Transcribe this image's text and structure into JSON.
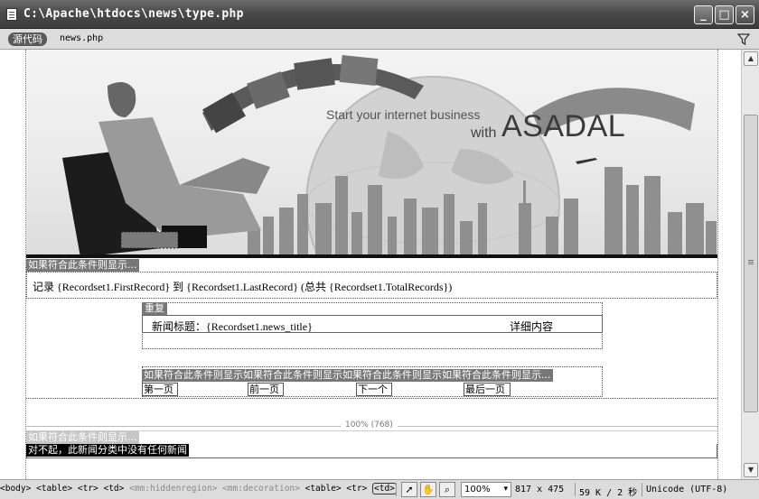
{
  "window": {
    "title": "C:\\Apache\\htdocs\\news\\type.php",
    "buttons": {
      "minimize": "_",
      "maximize": "□",
      "close": "×"
    }
  },
  "tabs": {
    "source_label": "源代码",
    "file_label": "news.php"
  },
  "banner": {
    "tagline": "Start your internet business",
    "with": "with",
    "brand": "ASADAL"
  },
  "content": {
    "condition_label": "如果符合此条件则显示...",
    "records_lead": "记录",
    "records_expr": "{Recordset1.FirstRecord} 到 {Recordset1.LastRecord} (总共 {Recordset1.TotalRecords})",
    "repeat_label": "重复",
    "news_title_label": "新闻标题：",
    "news_title_var": "{Recordset1.news_title}",
    "detail_label": "详细内容",
    "nav_condition": "如果符合此条件则显示如果符合此条件则显示如果符合此条件则显示如果符合此条件则显示...",
    "nav_links": [
      "第一页",
      "前一页",
      "下一个",
      "最后一页"
    ],
    "ruler_label": "100% (768)",
    "ghost_label": "如果符合此条件则显示...",
    "empty_message": "对不起，此新闻分类中没有任何新闻"
  },
  "statusbar": {
    "tags": [
      "<body>",
      "<table>",
      "<tr>",
      "<td>",
      "<mm:hiddenregion>",
      "<mm:decoration>",
      "<table>",
      "<tr>",
      "<td>"
    ],
    "zoom": "100%",
    "dimensions": "817 x 475",
    "size_time": "59 K / 2 秒",
    "encoding": "Unicode (UTF-8)"
  }
}
